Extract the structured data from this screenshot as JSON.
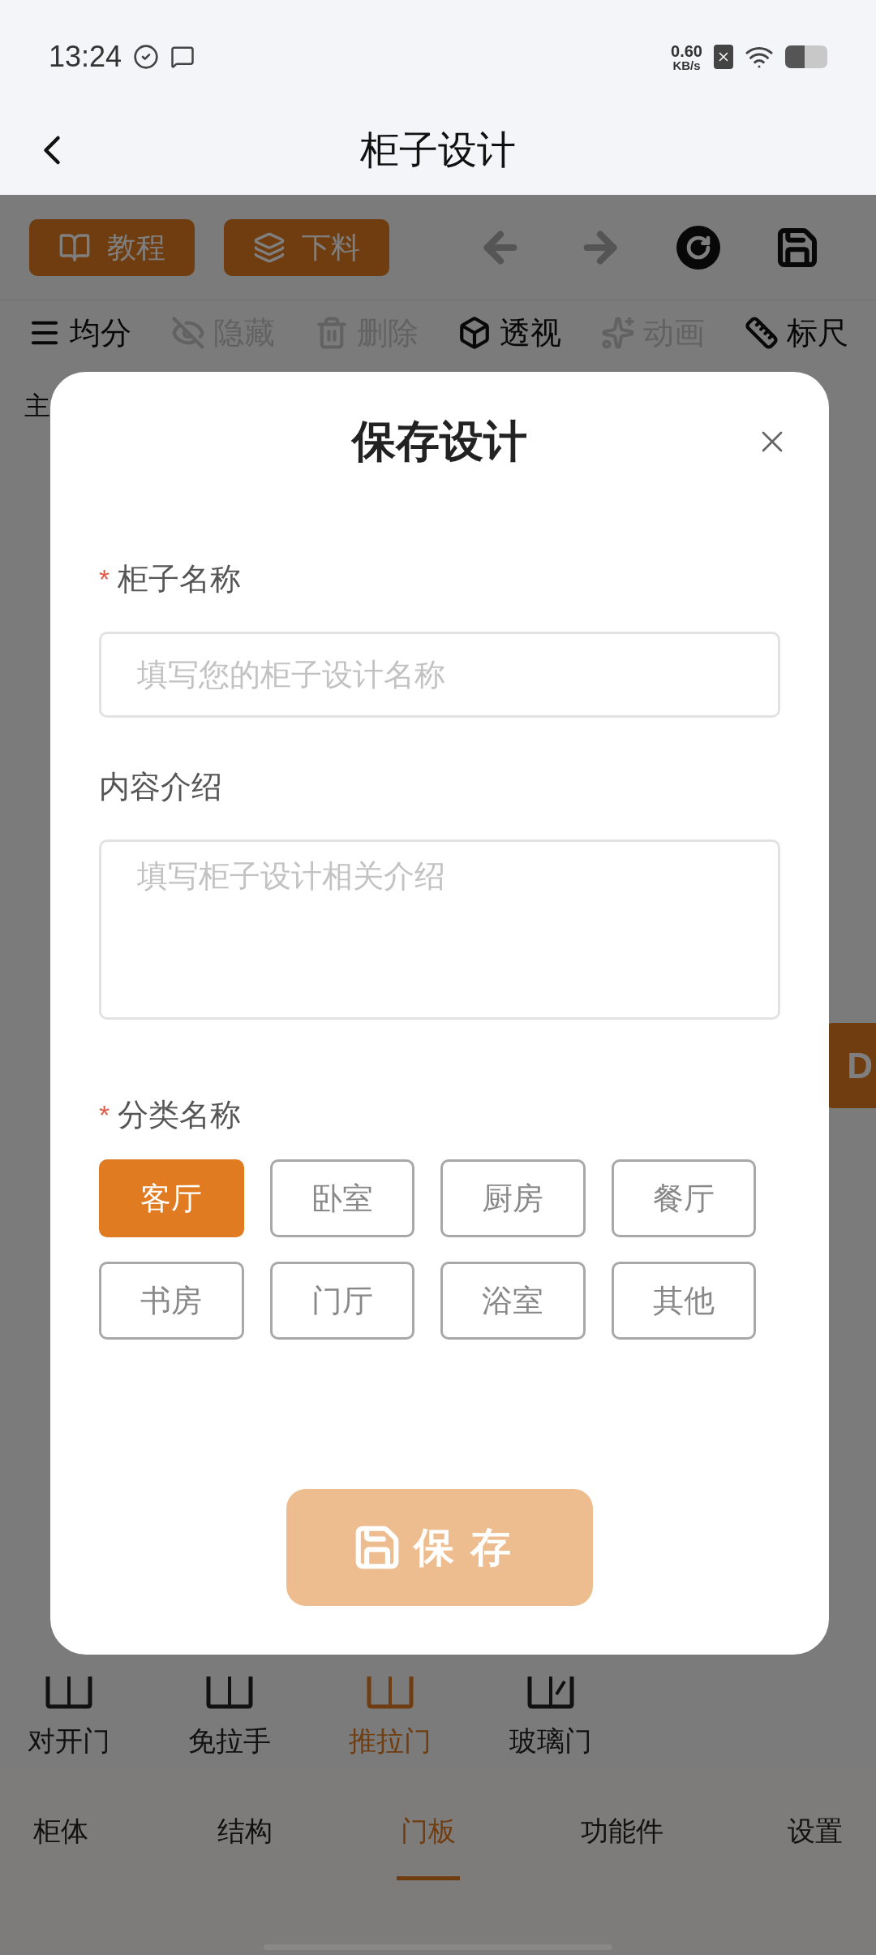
{
  "status_bar": {
    "time": "13:24",
    "net_speed": "0.60",
    "net_unit": "KB/s"
  },
  "nav": {
    "title": "柜子设计"
  },
  "toolbar": {
    "buttons": [
      {
        "label": "教程",
        "kind": "book"
      },
      {
        "label": "下料",
        "kind": "logs"
      }
    ]
  },
  "tools": [
    {
      "label": "均分",
      "kind": "menu",
      "disabled": false
    },
    {
      "label": "隐藏",
      "kind": "eye",
      "disabled": true
    },
    {
      "label": "删除",
      "kind": "trash",
      "disabled": true
    },
    {
      "label": "透视",
      "kind": "cube",
      "disabled": false
    },
    {
      "label": "动画",
      "kind": "star",
      "disabled": true
    },
    {
      "label": "标尺",
      "kind": "ruler",
      "disabled": false
    }
  ],
  "side_label": "主",
  "side_tab": "D",
  "door_types": [
    {
      "label": "对开门",
      "selected": false
    },
    {
      "label": "免拉手",
      "selected": false
    },
    {
      "label": "推拉门",
      "selected": true
    },
    {
      "label": "玻璃门",
      "selected": false
    }
  ],
  "tabs": [
    {
      "label": "柜体",
      "selected": false
    },
    {
      "label": "结构",
      "selected": false
    },
    {
      "label": "门板",
      "selected": true
    },
    {
      "label": "功能件",
      "selected": false
    },
    {
      "label": "设置",
      "selected": false
    }
  ],
  "dialog": {
    "title": "保存设计",
    "required_mark": "*",
    "fields": [
      {
        "label": "柜子名称",
        "required": true,
        "placeholder": "填写您的柜子设计名称",
        "kind": "input"
      },
      {
        "label": "内容介绍",
        "required": false,
        "placeholder": "填写柜子设计相关介绍",
        "kind": "textarea"
      }
    ],
    "category": {
      "label": "分类名称",
      "required": true,
      "options": [
        {
          "label": "客厅",
          "selected": true
        },
        {
          "label": "卧室",
          "selected": false
        },
        {
          "label": "厨房",
          "selected": false
        },
        {
          "label": "餐厅",
          "selected": false
        },
        {
          "label": "书房",
          "selected": false
        },
        {
          "label": "门厅",
          "selected": false
        },
        {
          "label": "浴室",
          "selected": false
        },
        {
          "label": "其他",
          "selected": false
        }
      ]
    },
    "save_button": {
      "label": "保存",
      "disabled": true
    }
  }
}
